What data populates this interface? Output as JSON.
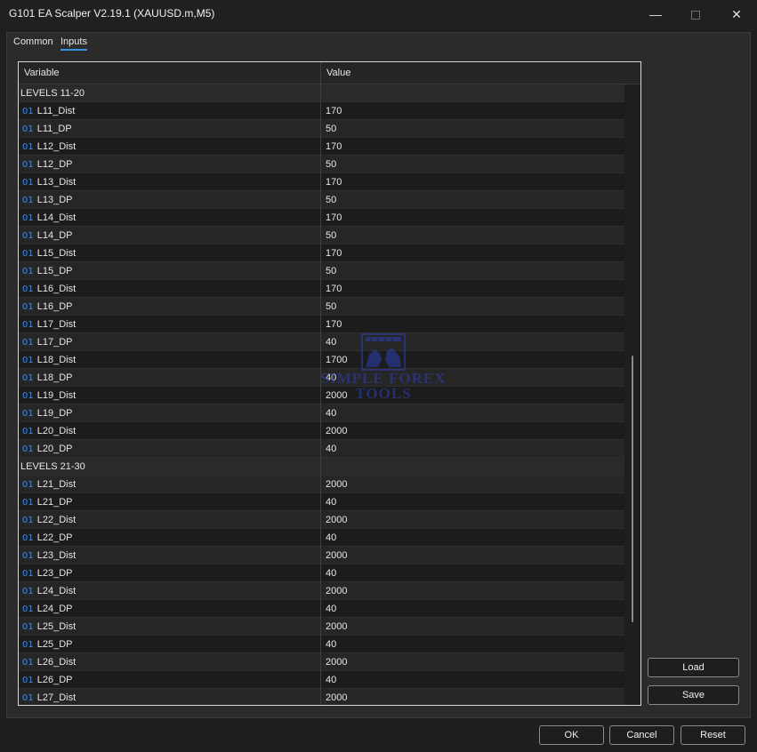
{
  "window": {
    "title": "G101 EA Scalper V2.19.1 (XAUUSD.m,M5)",
    "minimize_glyph": "—",
    "close_glyph": "✕"
  },
  "tabs": [
    {
      "label": "Common",
      "active": false
    },
    {
      "label": "Inputs",
      "active": true
    }
  ],
  "grid": {
    "headers": {
      "variable": "Variable",
      "value": "Value"
    },
    "type_badge": "01",
    "rows": [
      {
        "variable": "LEVELS 11-20",
        "value": "",
        "group": true
      },
      {
        "variable": "L11_Dist",
        "value": "170"
      },
      {
        "variable": "L11_DP",
        "value": "50"
      },
      {
        "variable": "L12_Dist",
        "value": "170"
      },
      {
        "variable": "L12_DP",
        "value": "50"
      },
      {
        "variable": "L13_Dist",
        "value": "170"
      },
      {
        "variable": "L13_DP",
        "value": "50"
      },
      {
        "variable": "L14_Dist",
        "value": "170"
      },
      {
        "variable": "L14_DP",
        "value": "50"
      },
      {
        "variable": "L15_Dist",
        "value": "170"
      },
      {
        "variable": "L15_DP",
        "value": "50"
      },
      {
        "variable": "L16_Dist",
        "value": "170"
      },
      {
        "variable": "L16_DP",
        "value": "50"
      },
      {
        "variable": "L17_Dist",
        "value": "170"
      },
      {
        "variable": "L17_DP",
        "value": "40"
      },
      {
        "variable": "L18_Dist",
        "value": "1700"
      },
      {
        "variable": "L18_DP",
        "value": "40"
      },
      {
        "variable": "L19_Dist",
        "value": "2000"
      },
      {
        "variable": "L19_DP",
        "value": "40"
      },
      {
        "variable": "L20_Dist",
        "value": "2000"
      },
      {
        "variable": "L20_DP",
        "value": "40"
      },
      {
        "variable": "LEVELS 21-30",
        "value": "",
        "group": true
      },
      {
        "variable": "L21_Dist",
        "value": "2000"
      },
      {
        "variable": "L21_DP",
        "value": "40"
      },
      {
        "variable": "L22_Dist",
        "value": "2000"
      },
      {
        "variable": "L22_DP",
        "value": "40"
      },
      {
        "variable": "L23_Dist",
        "value": "2000"
      },
      {
        "variable": "L23_DP",
        "value": "40"
      },
      {
        "variable": "L24_Dist",
        "value": "2000"
      },
      {
        "variable": "L24_DP",
        "value": "40"
      },
      {
        "variable": "L25_Dist",
        "value": "2000"
      },
      {
        "variable": "L25_DP",
        "value": "40"
      },
      {
        "variable": "L26_Dist",
        "value": "2000"
      },
      {
        "variable": "L26_DP",
        "value": "40"
      },
      {
        "variable": "L27_Dist",
        "value": "2000"
      }
    ]
  },
  "watermark": {
    "line1": "SIMPLE FOREX",
    "line2": "TOOLS",
    "color": "#2f3fb0"
  },
  "side_buttons": {
    "load": "Load",
    "save": "Save"
  },
  "footer": {
    "ok": "OK",
    "cancel": "Cancel",
    "reset": "Reset"
  },
  "colors": {
    "accent": "#3d8ee8",
    "background": "#1f1f1f"
  }
}
